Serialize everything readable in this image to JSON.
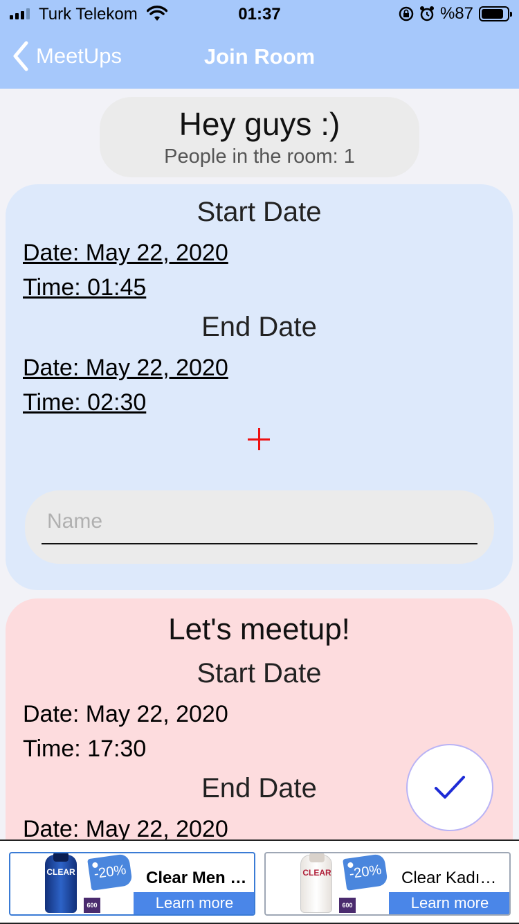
{
  "status_bar": {
    "carrier": "Turk Telekom",
    "time": "01:37",
    "battery": "%87"
  },
  "nav": {
    "back_label": "MeetUps",
    "title": "Join Room"
  },
  "room": {
    "title": "Hey guys :)",
    "people": "People in the room: 1"
  },
  "suggestion": {
    "start_title": "Start Date",
    "start_date": "Date: May 22, 2020",
    "start_time": "Time: 01:45",
    "end_title": "End Date",
    "end_date": "Date: May 22, 2020",
    "end_time": "Time: 02:30",
    "name_placeholder": "Name"
  },
  "meetup": {
    "title": "Let's meetup!",
    "start_title": "Start Date",
    "start_date": "Date: May 22, 2020",
    "start_time": "Time: 17:30",
    "end_title": "End Date",
    "end_date": "Date: May 22, 2020"
  },
  "ads": [
    {
      "title": "Clear Men C...",
      "cta": "Learn more",
      "badge": "-20%",
      "size": "600"
    },
    {
      "title": "Clear Kadınl...",
      "cta": "Learn more",
      "badge": "-20%",
      "size": "600"
    }
  ],
  "colors": {
    "nav_bg": "#a6c8fb",
    "card_blue": "#dde9fb",
    "card_pink": "#fddcde",
    "plus": "#ee1111",
    "check": "#1d2bd6"
  }
}
